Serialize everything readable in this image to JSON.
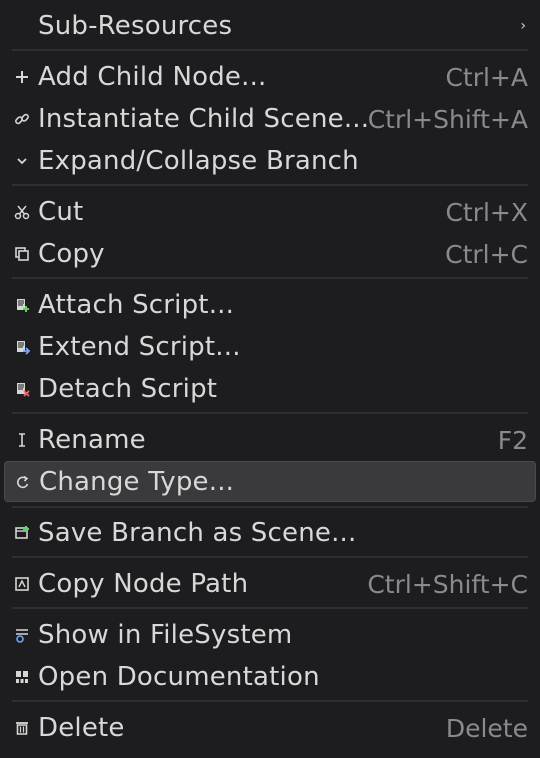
{
  "menu": {
    "items": [
      {
        "label": "Sub-Resources",
        "shortcut": "",
        "icon": "none",
        "submenu_arrow": "›"
      },
      {
        "label": "Add Child Node...",
        "shortcut": "Ctrl+A",
        "icon": "plus-icon"
      },
      {
        "label": "Instantiate Child Scene...",
        "shortcut": "Ctrl+Shift+A",
        "icon": "link-icon"
      },
      {
        "label": "Expand/Collapse Branch",
        "shortcut": "",
        "icon": "chevron-down-icon"
      },
      {
        "label": "Cut",
        "shortcut": "Ctrl+X",
        "icon": "scissors-icon"
      },
      {
        "label": "Copy",
        "shortcut": "Ctrl+C",
        "icon": "copy-icon"
      },
      {
        "label": "Attach Script...",
        "shortcut": "",
        "icon": "script-add-icon"
      },
      {
        "label": "Extend Script...",
        "shortcut": "",
        "icon": "script-extend-icon"
      },
      {
        "label": "Detach Script",
        "shortcut": "",
        "icon": "script-remove-icon"
      },
      {
        "label": "Rename",
        "shortcut": "F2",
        "icon": "text-cursor-icon"
      },
      {
        "label": "Change Type...",
        "shortcut": "",
        "icon": "rotate-icon",
        "highlighted": true
      },
      {
        "label": "Save Branch as Scene...",
        "shortcut": "",
        "icon": "save-scene-icon"
      },
      {
        "label": "Copy Node Path",
        "shortcut": "Ctrl+Shift+C",
        "icon": "copy-path-icon"
      },
      {
        "label": "Show in FileSystem",
        "shortcut": "",
        "icon": "filesystem-icon"
      },
      {
        "label": "Open Documentation",
        "shortcut": "",
        "icon": "documentation-icon"
      },
      {
        "label": "Delete",
        "shortcut": "Delete",
        "icon": "trash-icon"
      }
    ]
  },
  "colors": {
    "background": "#1d1d20",
    "highlight": "#3a3a3c",
    "text": "#d8d8d8",
    "shortcut_text": "#8a8a8c",
    "separator": "#2f2f32",
    "script_add_accent": "#5fd35f",
    "script_extend_accent": "#6fa8ff",
    "script_remove_accent": "#ff5f5f"
  }
}
